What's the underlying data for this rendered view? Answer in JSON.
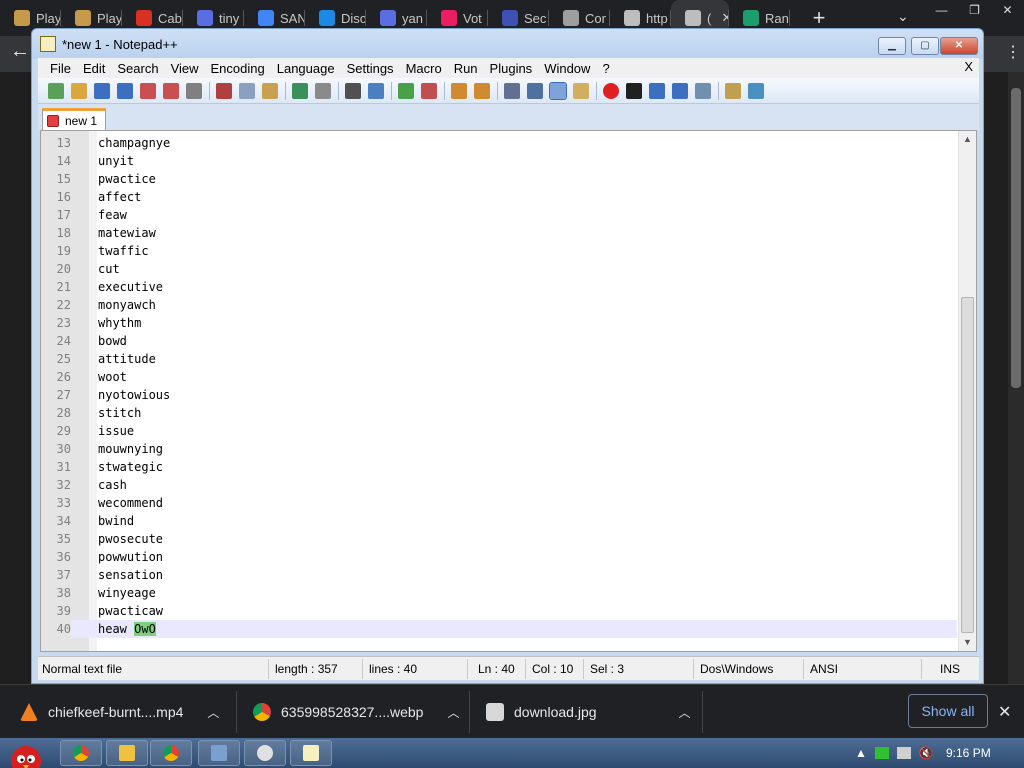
{
  "chrome": {
    "tabs": [
      {
        "label": "Play",
        "icon": "app-icon",
        "color": "#c59a4a"
      },
      {
        "label": "Play",
        "icon": "app-icon",
        "color": "#c59a4a"
      },
      {
        "label": "Cab",
        "icon": "gmail-icon",
        "color": "#d93025"
      },
      {
        "label": "tiny",
        "icon": "app-icon",
        "color": "#5b6ee1"
      },
      {
        "label": "SAN",
        "icon": "google-icon",
        "color": "#4285f4"
      },
      {
        "label": "Disc",
        "icon": "app-icon",
        "color": "#1e88e5"
      },
      {
        "label": "yan",
        "icon": "app-icon",
        "color": "#5b6ee1"
      },
      {
        "label": "Vot",
        "icon": "app-icon",
        "color": "#e91e63"
      },
      {
        "label": "Sec",
        "icon": "app-icon",
        "color": "#3f51b5"
      },
      {
        "label": "Cor",
        "icon": "app-icon",
        "color": "#9e9e9e"
      },
      {
        "label": "http",
        "icon": "globe-icon",
        "color": "#bdbdbd"
      },
      {
        "label": "(",
        "icon": "globe-icon",
        "color": "#bdbdbd",
        "active": true
      },
      {
        "label": "Ran",
        "icon": "app-icon",
        "color": "#1b9e6b"
      }
    ],
    "new_tab": "+",
    "menu_chevron": "⌄",
    "back": "←",
    "more": "⋮"
  },
  "notepad": {
    "title": "*new  1 - Notepad++",
    "menu": [
      "File",
      "Edit",
      "Search",
      "View",
      "Encoding",
      "Language",
      "Settings",
      "Macro",
      "Run",
      "Plugins",
      "Window",
      "?"
    ],
    "menu_close": "X",
    "doc_tab": "new  1",
    "lines": [
      {
        "n": "13",
        "text": "champagnye"
      },
      {
        "n": "14",
        "text": "unyit"
      },
      {
        "n": "15",
        "text": "pwactice"
      },
      {
        "n": "16",
        "text": "affect"
      },
      {
        "n": "17",
        "text": "feaw"
      },
      {
        "n": "18",
        "text": "matewiaw"
      },
      {
        "n": "19",
        "text": "twaffic"
      },
      {
        "n": "20",
        "text": "cut"
      },
      {
        "n": "21",
        "text": "executive"
      },
      {
        "n": "22",
        "text": "monyawch"
      },
      {
        "n": "23",
        "text": "whythm"
      },
      {
        "n": "24",
        "text": "bowd"
      },
      {
        "n": "25",
        "text": "attitude"
      },
      {
        "n": "26",
        "text": "woot"
      },
      {
        "n": "27",
        "text": "nyotowious"
      },
      {
        "n": "28",
        "text": "stitch"
      },
      {
        "n": "29",
        "text": "issue"
      },
      {
        "n": "30",
        "text": "mouwnying"
      },
      {
        "n": "31",
        "text": "stwategic"
      },
      {
        "n": "32",
        "text": "cash"
      },
      {
        "n": "33",
        "text": "wecommend"
      },
      {
        "n": "34",
        "text": "bwind"
      },
      {
        "n": "35",
        "text": "pwosecute"
      },
      {
        "n": "36",
        "text": "powwution"
      },
      {
        "n": "37",
        "text": "sensation"
      },
      {
        "n": "38",
        "text": "winyeage"
      },
      {
        "n": "39",
        "text": "pwacticaw"
      }
    ],
    "last_line": {
      "n": "40",
      "text": "heaw ",
      "selected": "OwO"
    },
    "status": {
      "type": "Normal text file",
      "length": "length : 357",
      "lines": "lines : 40",
      "ln": "Ln : 40",
      "col": "Col : 10",
      "sel": "Sel : 3",
      "eol": "Dos\\Windows",
      "encoding": "ANSI",
      "mode": "INS"
    }
  },
  "downloads": {
    "items": [
      {
        "name": "chiefkeef-burnt....mp4",
        "icon": "vlc-icon"
      },
      {
        "name": "635998528327....webp",
        "icon": "chrome-icon"
      },
      {
        "name": "download.jpg",
        "icon": "image-file-icon"
      }
    ],
    "show_all": "Show all",
    "close": "✕"
  },
  "taskbar": {
    "clock": "9:16 PM"
  }
}
